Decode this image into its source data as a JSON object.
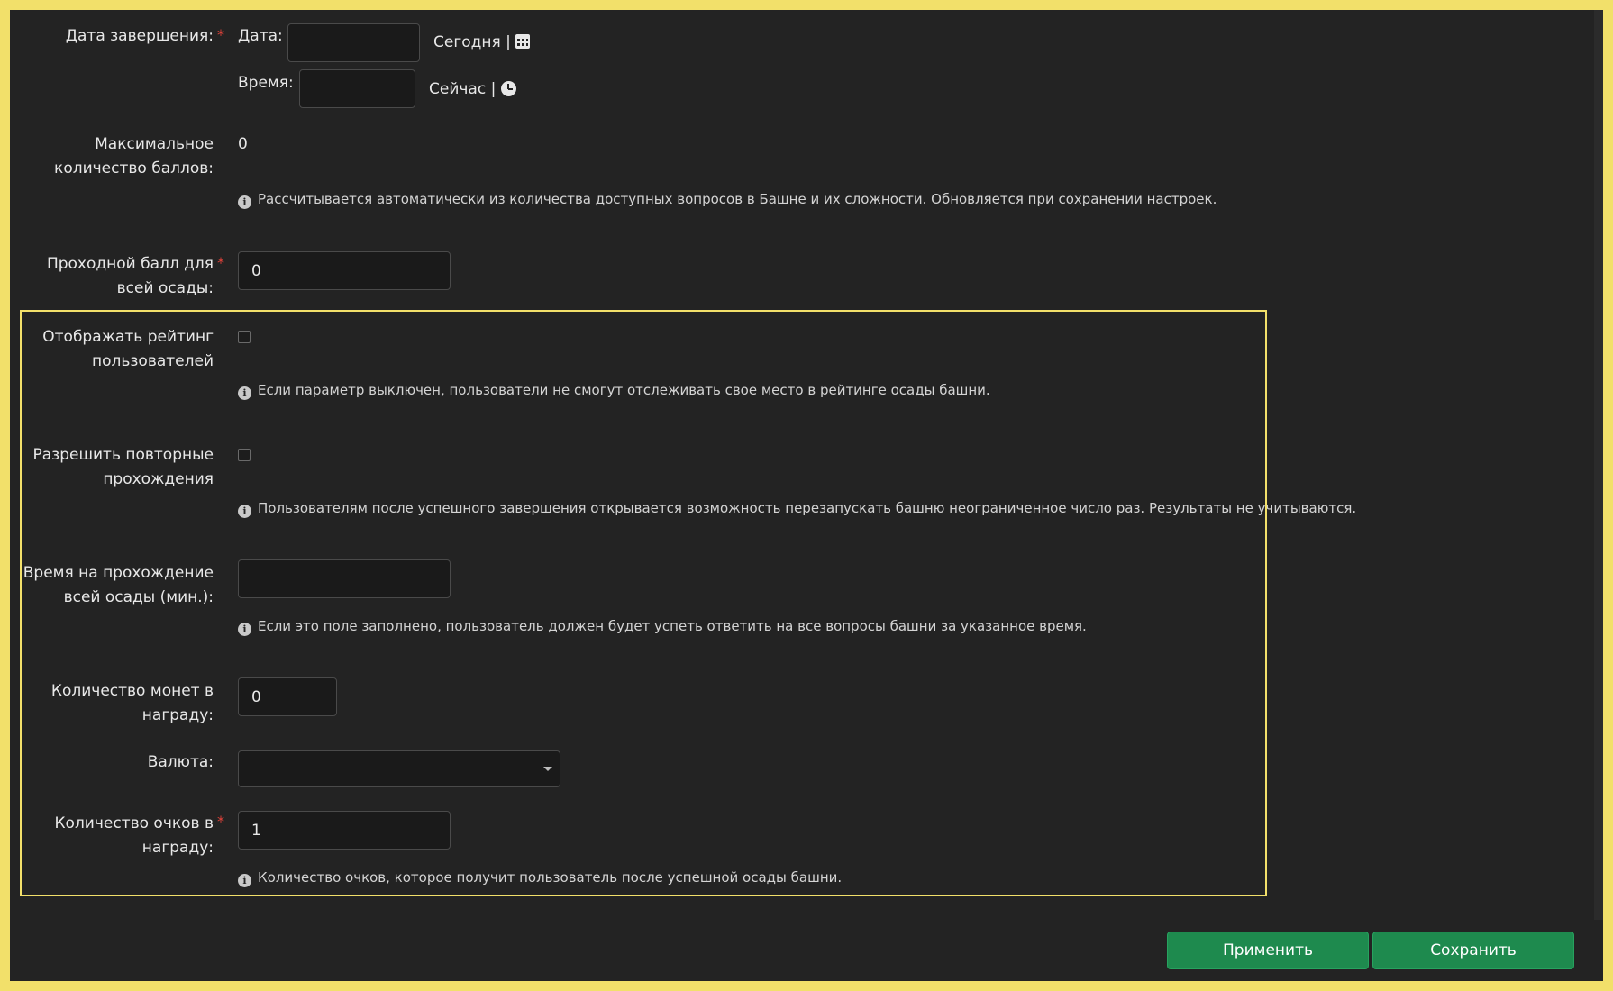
{
  "end_date": {
    "label": "Дата завершения:",
    "required_mark": "*",
    "date_label": "Дата:",
    "date_value": "",
    "today_link": "Сегодня",
    "separator": "|",
    "time_label": "Время:",
    "time_value": "",
    "now_link": "Сейчас",
    "calendar_icon": "calendar-icon",
    "clock_icon": "clock-icon"
  },
  "max_score": {
    "label_line1": "Максимальное",
    "label_line2": "количество баллов:",
    "value": "0",
    "help": "Рассчитывается автоматически из количества доступных вопросов в Башне и их сложности. Обновляется при сохранении настроек."
  },
  "passing_score": {
    "label_line1": "Проходной балл для",
    "label_line2": "всей осады:",
    "required_mark": "*",
    "value": "0"
  },
  "show_rating": {
    "label_line1": "Отображать рейтинг",
    "label_line2": "пользователей",
    "checked": false,
    "help": "Если параметр выключен, пользователи не смогут отслеживать свое место в рейтинге осады башни."
  },
  "allow_repeat": {
    "label_line1": "Разрешить повторные",
    "label_line2": "прохождения",
    "checked": false,
    "help": "Пользователям после успешного завершения открывается возможность перезапускать башню неограниченное число раз. Результаты не учитываются."
  },
  "time_limit": {
    "label_line1": "Время на прохождение",
    "label_line2": "всей осады (мин.):",
    "value": "",
    "help": "Если это поле заполнено, пользователь должен будет успеть ответить на все вопросы башни за указанное время."
  },
  "coins_reward": {
    "label_line1": "Количество монет в",
    "label_line2": "награду:",
    "value": "0"
  },
  "currency": {
    "label": "Валюта:",
    "selected": ""
  },
  "points_reward": {
    "label_line1": "Количество очков в",
    "label_line2": "награду:",
    "required_mark": "*",
    "value": "1",
    "help": "Количество очков, которое получит пользователь после успешной осады башни."
  },
  "buttons": {
    "apply": "Применить",
    "save": "Сохранить"
  },
  "info_icon": "info-icon",
  "colors": {
    "background": "#232323",
    "accent_button": "#1e8a4e",
    "highlight_border": "#f2e06a",
    "required": "#e0423a"
  }
}
